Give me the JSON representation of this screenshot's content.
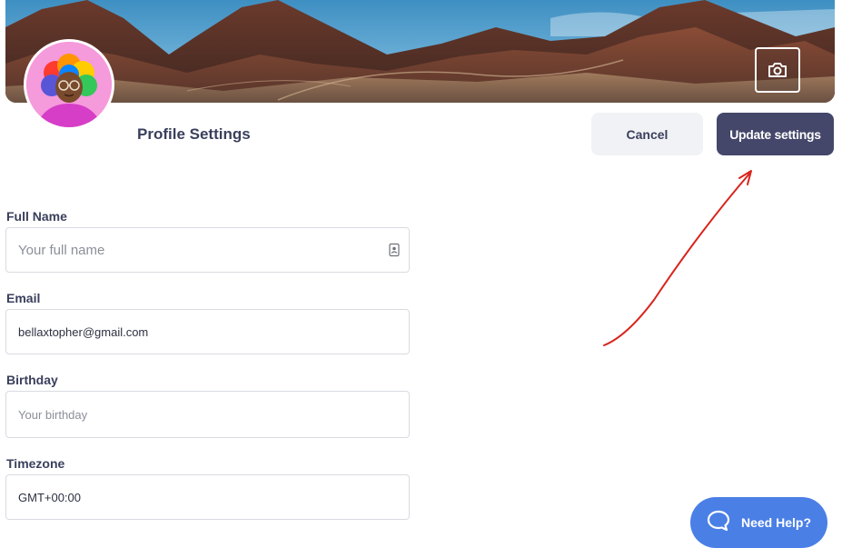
{
  "header": {
    "title": "Profile Settings",
    "cancel_label": "Cancel",
    "update_label": "Update settings"
  },
  "cover": {
    "change_icon": "camera-icon"
  },
  "avatar": {
    "icon": "memoji-avatar"
  },
  "form": {
    "full_name": {
      "label": "Full Name",
      "placeholder": "Your full name",
      "value": "",
      "icon": "contact-card-icon"
    },
    "email": {
      "label": "Email",
      "placeholder": "",
      "value": "bellaxtopher@gmail.com"
    },
    "birthday": {
      "label": "Birthday",
      "placeholder": "Your birthday",
      "value": ""
    },
    "timezone": {
      "label": "Timezone",
      "placeholder": "",
      "value": "GMT+00:00"
    }
  },
  "help": {
    "label": "Need Help?",
    "icon": "chat-bubble-icon"
  },
  "colors": {
    "primary_button": "#44466a",
    "secondary_button": "#f1f2f5",
    "help_button": "#4a7fe6",
    "annotation_arrow": "#d9241c"
  }
}
